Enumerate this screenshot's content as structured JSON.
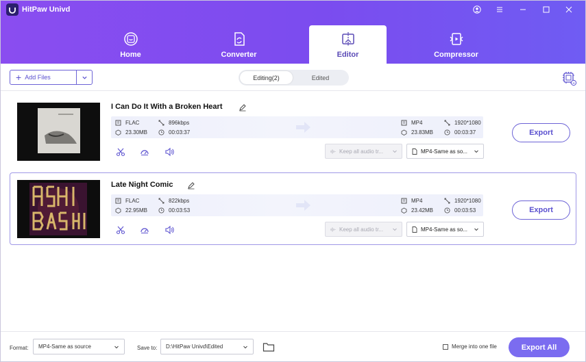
{
  "app": {
    "title": "HitPaw Univd"
  },
  "tabs": [
    {
      "label": "Home",
      "icon": "home-icon"
    },
    {
      "label": "Converter",
      "icon": "converter-icon"
    },
    {
      "label": "Editor",
      "icon": "editor-icon",
      "active": true
    },
    {
      "label": "Compressor",
      "icon": "compressor-icon"
    }
  ],
  "toolbar": {
    "add_files_label": "Add Files",
    "segments": [
      {
        "label": "Editing(2)",
        "active": true
      },
      {
        "label": "Edited",
        "active": false
      }
    ]
  },
  "files": [
    {
      "title": "I Can Do It With a Broken Heart",
      "source": {
        "format": "FLAC",
        "bitrate": "896kbps",
        "size": "23.30MB",
        "duration": "00:03:37"
      },
      "output": {
        "format": "MP4",
        "resolution": "1920*1080",
        "size": "23.83MB",
        "duration": "00:03:37"
      },
      "audio_select": "Keep all audio tr...",
      "format_select": "MP4-Same as so...",
      "export_label": "Export",
      "selected": false
    },
    {
      "title": "Late Night Comic",
      "source": {
        "format": "FLAC",
        "bitrate": "822kbps",
        "size": "22.95MB",
        "duration": "00:03:53"
      },
      "output": {
        "format": "MP4",
        "resolution": "1920*1080",
        "size": "23.42MB",
        "duration": "00:03:53"
      },
      "audio_select": "Keep all audio tr...",
      "format_select": "MP4-Same as so...",
      "export_label": "Export",
      "selected": true
    }
  ],
  "footer": {
    "format_label": "Format:",
    "format_value": "MP4-Same as source",
    "save_to_label": "Save to:",
    "save_to_value": "D:\\HitPaw Univd\\Edited",
    "merge_label": "Merge into one file",
    "merge_checked": false,
    "export_all_label": "Export All"
  },
  "colors": {
    "brand": "#7b4cef",
    "accent": "#6b62d6",
    "export_all": "#7b6cf0"
  }
}
